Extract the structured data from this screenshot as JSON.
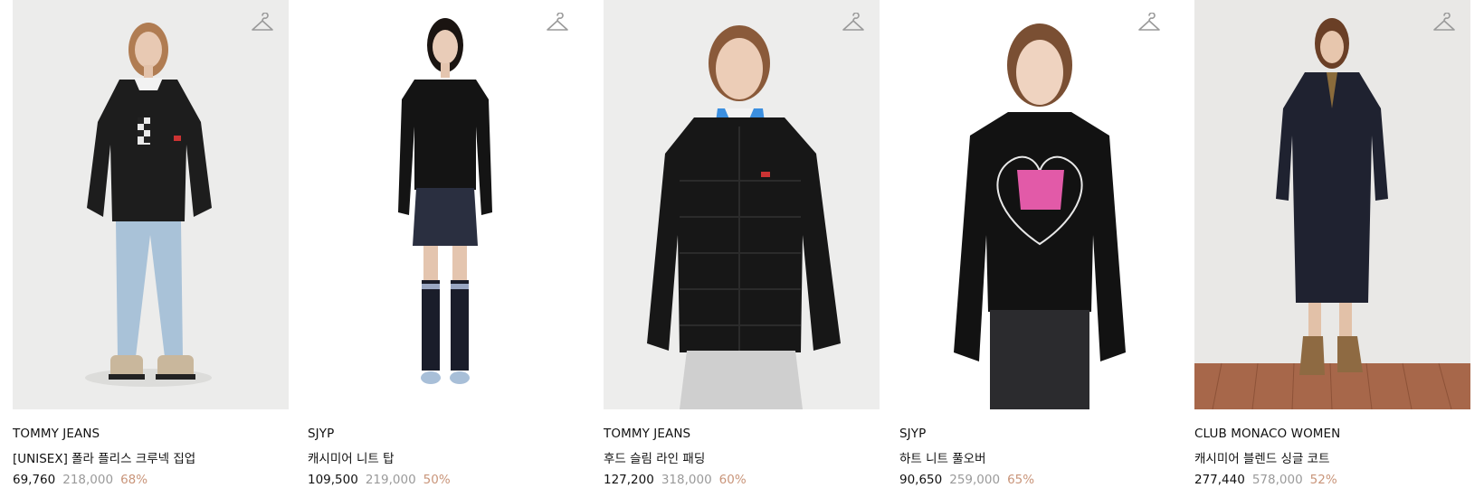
{
  "products": [
    {
      "brand": "TOMMY JEANS",
      "name": "[UNISEX] 폴라 플리스 크루넥 집업",
      "price": "69,760",
      "original_price": "218,000",
      "discount": "68%",
      "icon": "hanger-icon",
      "bg_color": "#ececeb"
    },
    {
      "brand": "SJYP",
      "name": "캐시미어 니트 탑",
      "price": "109,500",
      "original_price": "219,000",
      "discount": "50%",
      "icon": "hanger-icon",
      "bg_color": "#ffffff"
    },
    {
      "brand": "TOMMY JEANS",
      "name": "후드 슬림 라인 패딩",
      "price": "127,200",
      "original_price": "318,000",
      "discount": "60%",
      "icon": "hanger-icon",
      "bg_color": "#ededec"
    },
    {
      "brand": "SJYP",
      "name": "하트 니트 풀오버",
      "price": "90,650",
      "original_price": "259,000",
      "discount": "65%",
      "icon": "hanger-icon",
      "bg_color": "#ffffff"
    },
    {
      "brand": "CLUB MONACO WOMEN",
      "name": "캐시미어 블렌드 싱글 코트",
      "price": "277,440",
      "original_price": "578,000",
      "discount": "52%",
      "icon": "hanger-icon",
      "bg_color": "#e9e8e6"
    }
  ]
}
